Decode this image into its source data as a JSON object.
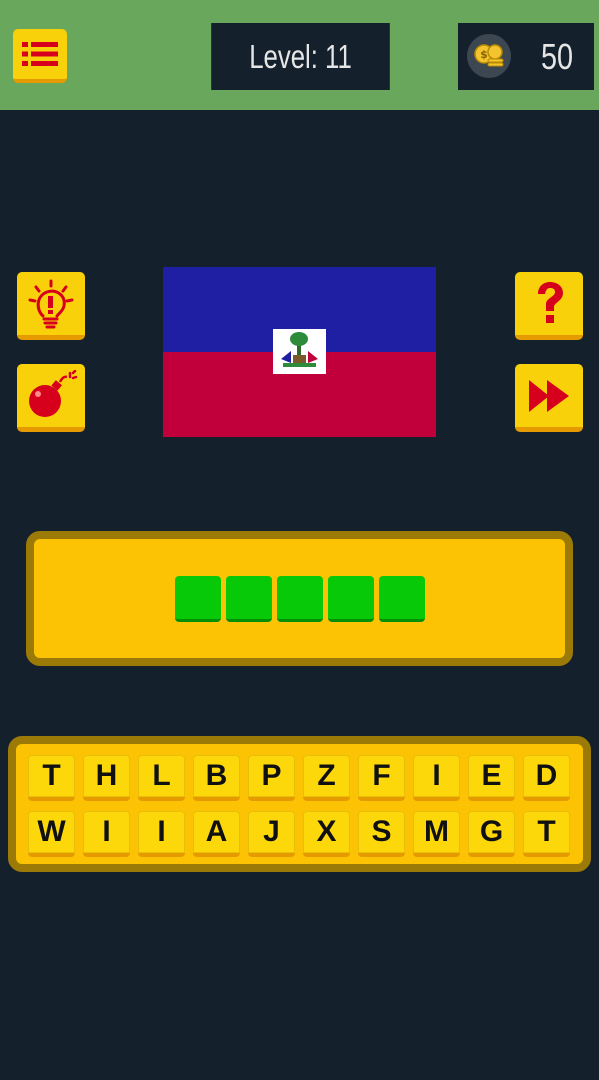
{
  "header": {
    "level_label": "Level: 11",
    "coins": "50"
  },
  "colors": {
    "background": "#14212d",
    "topbar": "#69a85c",
    "button_yellow": "#f9d10b",
    "panel_yellow": "#fcc304",
    "panel_border": "#9c7a07",
    "slot_green": "#07c907",
    "icon_red": "#d6001c",
    "flag_blue": "#1f1fa3",
    "flag_red": "#c1003b"
  },
  "icons": {
    "menu": "list-icon",
    "coins": "coins-icon",
    "hint": "lightbulb-icon",
    "bomb": "bomb-icon",
    "help": "question-mark-icon",
    "skip": "fast-forward-icon"
  },
  "flag": {
    "country_shown": "Haiti"
  },
  "answer": {
    "slot_count": 5,
    "slots": [
      "",
      "",
      "",
      "",
      ""
    ]
  },
  "keyboard": {
    "row1": [
      "T",
      "H",
      "L",
      "B",
      "P",
      "Z",
      "F",
      "I",
      "E",
      "D"
    ],
    "row2": [
      "W",
      "I",
      "I",
      "A",
      "J",
      "X",
      "S",
      "M",
      "G",
      "T"
    ]
  }
}
